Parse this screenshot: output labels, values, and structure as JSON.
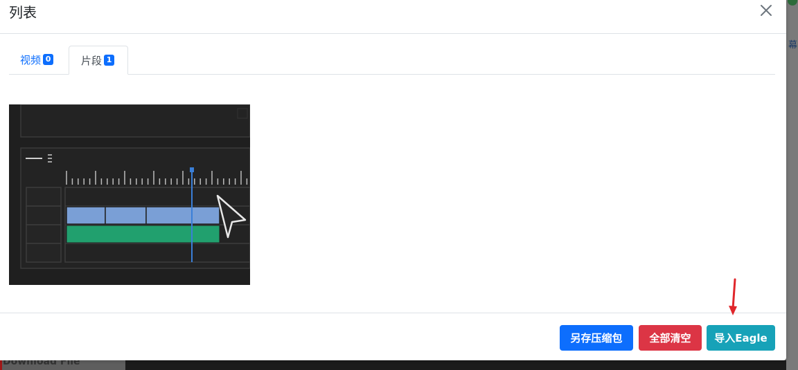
{
  "modal": {
    "title": "列表",
    "close_icon": "close-icon"
  },
  "tabs": [
    {
      "label": "视频",
      "count": "0",
      "active": false
    },
    {
      "label": "片段",
      "count": "1",
      "active": true
    }
  ],
  "clip_thumbnail": {
    "description_icon": "timeline-editor-thumbnail"
  },
  "footer": {
    "save_zip_label": "另存压缩包",
    "clear_all_label": "全部清空",
    "import_eagle_label": "导入Eagle"
  },
  "background": {
    "right_peek_text": "幕",
    "bottom_left_peek_text": "Download File"
  },
  "colors": {
    "primary": "#0d6efd",
    "danger": "#dc3545",
    "info": "#17a2b8",
    "annotation_red": "#e0262b",
    "timeline_blue": "#7a9fd6",
    "timeline_green": "#21a06e"
  }
}
